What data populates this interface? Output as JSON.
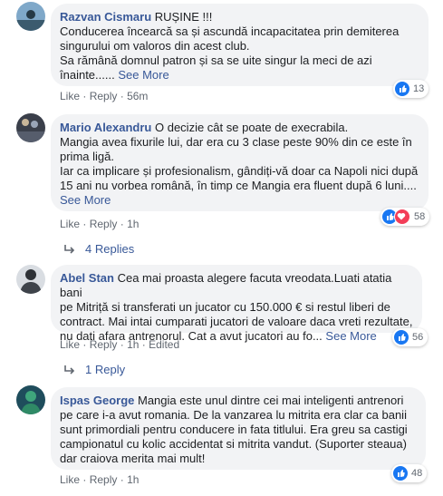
{
  "colors": {
    "link": "#385898",
    "meta": "#606770",
    "bubble": "#f2f3f5",
    "like": "#1877f2",
    "love": "#f33e58"
  },
  "actions": {
    "like": "Like",
    "reply": "Reply",
    "dot": "·",
    "edited": "Edited"
  },
  "comments": [
    {
      "author": "Razvan Cismaru",
      "text_inline": "RUȘINE !!!",
      "lines": [
        "Conducerea încearcă sa și ascundă incapacitatea prin demiterea",
        "singurului om valoros din acest club.",
        "Sa rămână domnul patron și sa se uite singur la meci de azi",
        "înainte......"
      ],
      "see_more": "See More",
      "time": "56m",
      "reactions": {
        "icons": [
          "like-icon"
        ],
        "count": "13"
      }
    },
    {
      "author": "Mario Alexandru",
      "text_inline": "O decizie cât se poate de execrabila.",
      "lines": [
        "Mangia avea fixurile lui, dar era cu 3 clase peste 90% din ce este în",
        "prima ligă.",
        "Iar ca implicare și profesionalism, gândiți-vă doar ca Napoli nici după",
        "15 ani nu vorbea română, în timp ce Mangia era fluent după 6 luni...."
      ],
      "see_more": "See More",
      "time": "1h",
      "reactions": {
        "icons": [
          "like-icon",
          "love-icon"
        ],
        "count": "58"
      },
      "replies": "4 Replies"
    },
    {
      "author": "Abel Stan",
      "text_inline": "Cea mai proasta alegere facuta vreodata.Luati atatia bani",
      "lines": [
        "pe Mitriță si transferati un jucator cu 150.000 € si restul liberi de",
        "contract. Mai intai cumparati jucatori de valoare daca vreti rezultate,",
        "nu dati afara antrenorul. Cat a avut jucatori au fo..."
      ],
      "see_more": "See More",
      "time": "1h",
      "edited": true,
      "reactions": {
        "icons": [
          "like-icon"
        ],
        "count": "56"
      },
      "replies": "1 Reply"
    },
    {
      "author": "Ispas George",
      "text_inline": "Mangia este unul dintre cei mai inteligenti antrenori",
      "lines": [
        "pe care i-a avut romania. De la vanzarea lu mitrita era clar ca banii",
        "sunt primordiali pentru conducere in fata titlului. Era greu sa castigi",
        "campionatul cu kolic accidentat si mitrita vandut. (Suporter steaua)",
        "dar craiova merita mai mult!"
      ],
      "time": "1h",
      "reactions": {
        "icons": [
          "like-icon"
        ],
        "count": "48"
      }
    }
  ]
}
